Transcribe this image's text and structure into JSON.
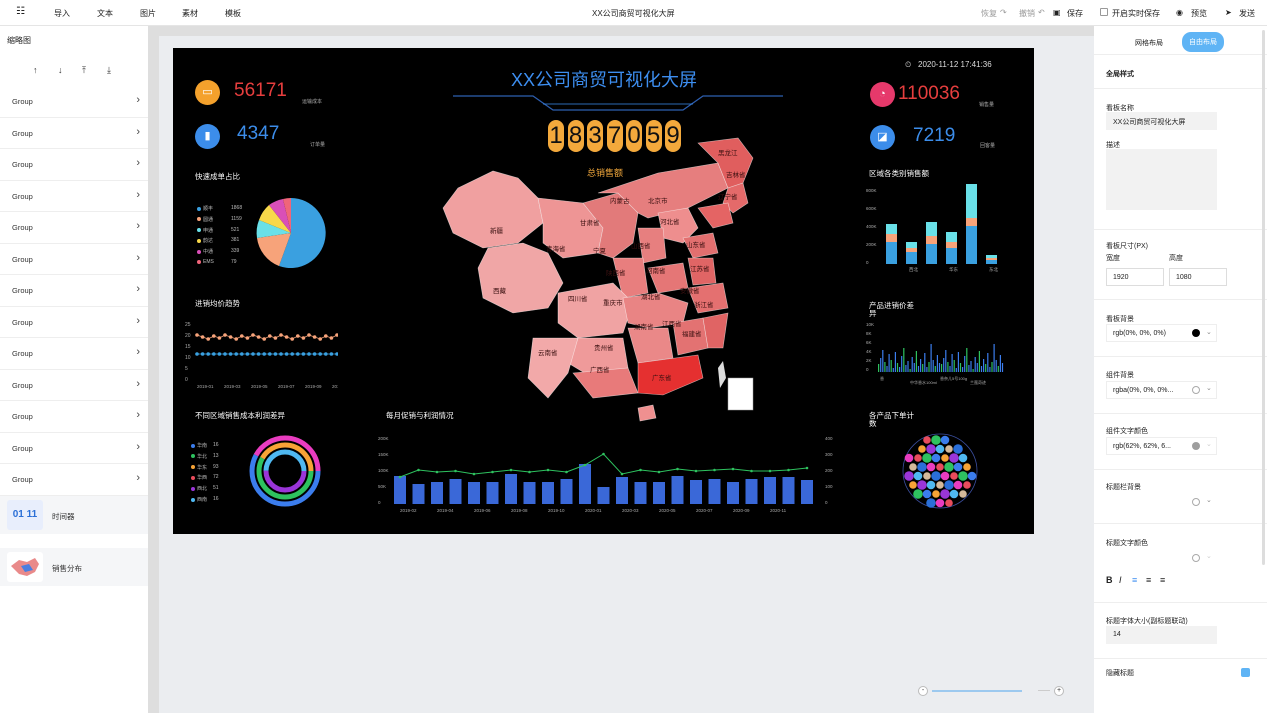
{
  "toolbar": {
    "import": "导入",
    "text": "文本",
    "image": "图片",
    "material": "素材",
    "template": "模板",
    "title": "XX公司商贸可视化大屏",
    "redo": "恢复",
    "undo": "撤销",
    "save": "保存",
    "realtime_save": "开启实时保存",
    "preview": "预览",
    "send": "发送"
  },
  "left": {
    "header": "缩略图",
    "groups": [
      "Group",
      "Group",
      "Group",
      "Group",
      "Group",
      "Group",
      "Group",
      "Group",
      "Group",
      "Group",
      "Group",
      "Group",
      "Group"
    ],
    "thumb1": "时间器",
    "thumb2": "销售分布"
  },
  "screen": {
    "title": "XX公司商贸可视化大屏",
    "datetime": "2020-11-12 17:41:36",
    "kpi1_value": "56171",
    "kpi1_label": "运输成本",
    "kpi2_value": "4347",
    "kpi2_label": "订单量",
    "kpi3_value": "110036",
    "kpi3_label": "销售量",
    "kpi4_value": "7219",
    "kpi4_label": "回客量",
    "digits": [
      "1",
      "8",
      "3",
      "7",
      "0",
      "5",
      "9"
    ],
    "total_label": "总销售额",
    "pie_title": "快速成单占比",
    "pie_legend": [
      {
        "name": "顺丰",
        "value": "1868",
        "color": "#3aa0e0"
      },
      {
        "name": "圆通",
        "value": "1159",
        "color": "#f7a37a"
      },
      {
        "name": "申通",
        "value": "521",
        "color": "#69e0e8"
      },
      {
        "name": "韵达",
        "value": "381",
        "color": "#f8d84a"
      },
      {
        "name": "中通",
        "value": "339",
        "color": "#d94fb8"
      },
      {
        "name": "EMS",
        "value": "79",
        "color": "#f0657a"
      }
    ],
    "line_title": "进销均价趋势",
    "line_x": [
      "2019-01",
      "2019-03",
      "2019-05",
      "2019-07",
      "2019-09",
      "2019-12"
    ],
    "line_y": [
      "25",
      "20",
      "15",
      "10",
      "5",
      "0"
    ],
    "donut_title": "不同区域销售成本利润差异",
    "donut_legend": [
      {
        "name": "华南",
        "value": "16",
        "color": "#3b7ded"
      },
      {
        "name": "华北",
        "value": "13",
        "color": "#2ec25f"
      },
      {
        "name": "华东",
        "value": "93",
        "color": "#f7a336"
      },
      {
        "name": "华西",
        "value": "72",
        "color": "#e94c5c"
      },
      {
        "name": "西北",
        "value": "51",
        "color": "#9a35d8"
      },
      {
        "name": "西南",
        "value": "16",
        "color": "#4fb8f0"
      }
    ],
    "combo_title": "每月促销与利润情况",
    "combo_x": [
      "2019-02",
      "2019-04",
      "2019-06",
      "2019-08",
      "2019-10",
      "2020-01",
      "2020-03",
      "2020-05",
      "2020-07",
      "2020-09",
      "2020-11"
    ],
    "combo_yl": [
      "200K",
      "150K",
      "100K",
      "50K",
      "0"
    ],
    "combo_yr": [
      "400",
      "300",
      "200",
      "100",
      "0"
    ],
    "stack_title": "区域各类别销售额",
    "stack_y": [
      "800K",
      "600K",
      "400K",
      "200K",
      "0"
    ],
    "stack_x": [
      "西北",
      "华东",
      "东北"
    ],
    "diff_title_1": "产品进销价差",
    "diff_title_2": "异",
    "diff_y": [
      "10K",
      "8K",
      "6K",
      "4K",
      "2K",
      "0"
    ],
    "diff_x": [
      "香",
      "中华香水100ml",
      "香奈儿5号100g",
      "兰蔻奇迹"
    ],
    "bubble_title_1": "各产品下单计",
    "bubble_title_2": "数",
    "provinces": [
      "黑龙江",
      "吉林省",
      "辽宁省",
      "内蒙古",
      "北京市",
      "河北省",
      "山西省",
      "山东省",
      "新疆",
      "甘肃省",
      "宁夏",
      "陕西省",
      "青海省",
      "河南省",
      "江苏省",
      "西藏",
      "四川省",
      "重庆市",
      "湖北省",
      "安徽省",
      "浙江省",
      "湖南省",
      "江西省",
      "福建省",
      "贵州省",
      "云南省",
      "广西省",
      "广东省"
    ]
  },
  "right": {
    "tab_grid": "网格布局",
    "tab_free": "自由布局",
    "global_style": "全局样式",
    "board_name_label": "看板名称",
    "board_name": "XX公司商贸可视化大屏",
    "desc_label": "描述",
    "size_label": "看板尺寸(PX)",
    "width_label": "宽度",
    "height_label": "高度",
    "width": "1920",
    "height": "1080",
    "bg_label": "看板背景",
    "bg_value": "rgb(0%, 0%, 0%)",
    "comp_bg_label": "组件背景",
    "comp_bg_value": "rgba(0%, 0%, 0%...",
    "comp_text_label": "组件文字颜色",
    "comp_text_value": "rgb(62%, 62%, 6...",
    "titlebar_bg_label": "标题栏背景",
    "title_color_label": "标题文字颜色",
    "font_size_label": "标题字体大小(副标题联动)",
    "font_size": "14",
    "hide_title_label": "隐藏标题"
  }
}
